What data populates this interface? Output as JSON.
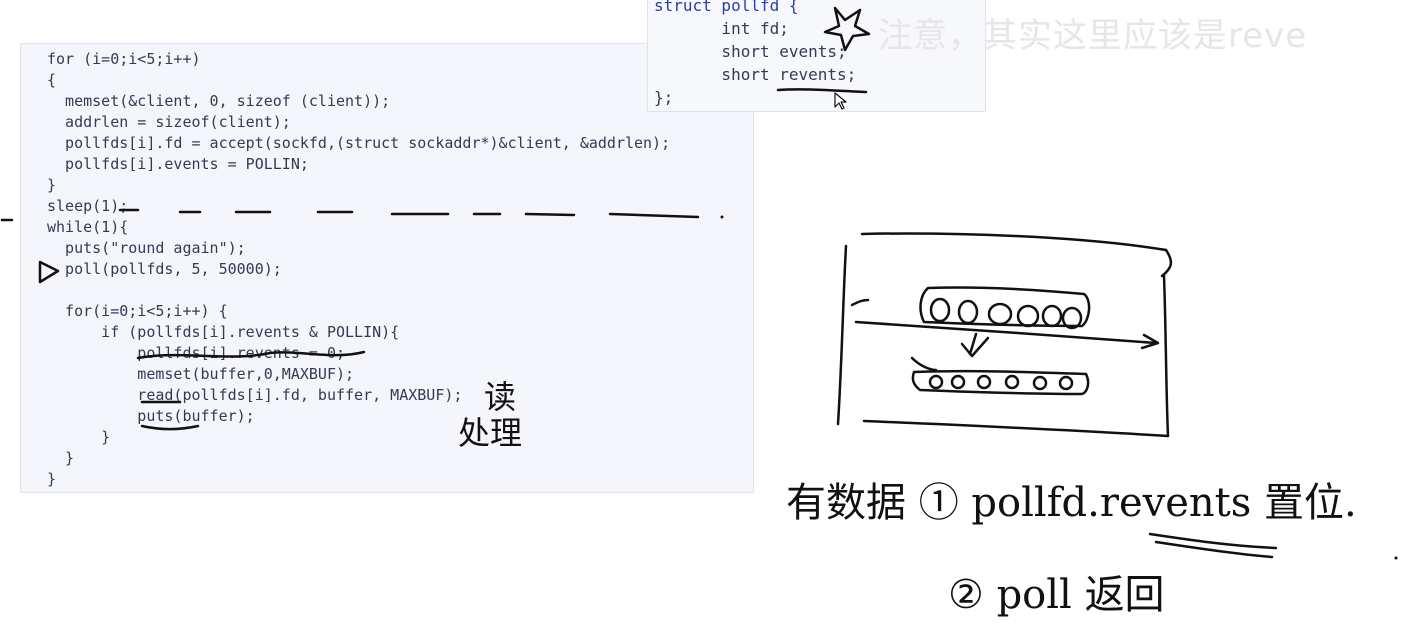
{
  "code": {
    "lines": [
      "for (i=0;i<5;i++)",
      "{",
      "  memset(&client, 0, sizeof (client));",
      "  addrlen = sizeof(client);",
      "  pollfds[i].fd = accept(sockfd,(struct sockaddr*)&client, &addrlen);",
      "  pollfds[i].events = POLLIN;",
      "}",
      "sleep(1);",
      "while(1){",
      "  puts(\"round again\");",
      "  poll(pollfds, 5, 50000);",
      "",
      "  for(i=0;i<5;i++) {",
      "      if (pollfds[i].revents & POLLIN){",
      "          pollfds[i].revents = 0;",
      "          memset(buffer,0,MAXBUF);",
      "          read(pollfds[i].fd, buffer, MAXBUF);",
      "          puts(buffer);",
      "      }",
      "  }",
      "}"
    ]
  },
  "popup": {
    "lines": [
      "struct pollfd {",
      "       int fd;",
      "       short events;",
      "       short revents;",
      "};"
    ]
  },
  "overlay_note": "注意，其实这里应该是reve",
  "annotations": {
    "read_process": [
      "读",
      "处理"
    ],
    "note_1": "有数据 ① pollfd.revents 置位.",
    "note_2": "② poll 返回"
  }
}
